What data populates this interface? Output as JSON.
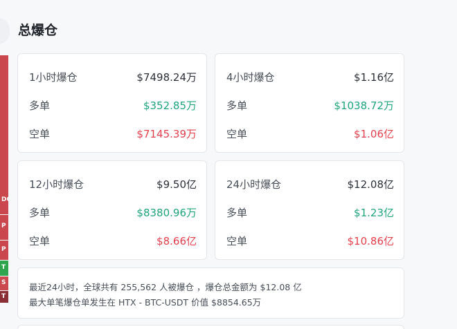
{
  "title": "总爆仓",
  "cards": [
    {
      "period": "1小时爆仓",
      "total": "$7498.24万",
      "long_label": "多单",
      "long": "$352.85万",
      "short_label": "空单",
      "short": "$7145.39万"
    },
    {
      "period": "4小时爆仓",
      "total": "$1.16亿",
      "long_label": "多单",
      "long": "$1038.72万",
      "short_label": "空单",
      "short": "$1.06亿"
    },
    {
      "period": "12小时爆仓",
      "total": "$9.50亿",
      "long_label": "多单",
      "long": "$8380.96万",
      "short_label": "空单",
      "short": "$8.66亿"
    },
    {
      "period": "24小时爆仓",
      "total": "$12.08亿",
      "long_label": "多单",
      "long": "$1.23亿",
      "short_label": "空单",
      "short": "$10.86亿"
    }
  ],
  "summary": {
    "line1": "最近24小时，全球共有 255,562 人被爆仓 ，爆仓总金额为 $12.08 亿",
    "line2": "最大单笔爆仓单发生在 HTX - BTC-USDT 价值 $8854.65万"
  },
  "strip_labels": [
    "DO",
    "P",
    "P",
    "T",
    "S",
    "T"
  ],
  "colors": {
    "long": "#1fa37a",
    "short": "#e23f4c",
    "strip_red": "#c9474d",
    "strip_green": "#2ea44f"
  }
}
